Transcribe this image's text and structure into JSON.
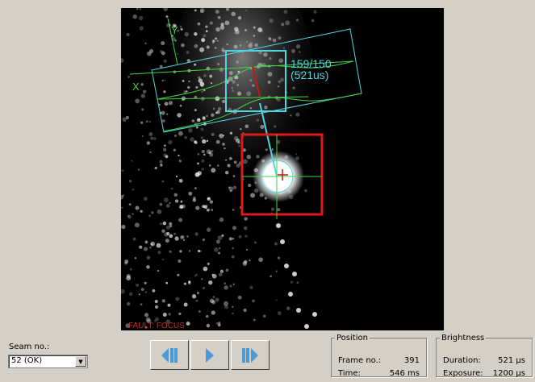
{
  "camera": {
    "overlay_value": "159/150",
    "overlay_time": "(521us)",
    "axis_x": "X",
    "axis_y": "Y",
    "fault": "FAULT: FOCUS"
  },
  "seam": {
    "label": "Seam no.:",
    "value": "52  (OK)"
  },
  "playback": {
    "prev": "step-back-icon",
    "play": "play-icon",
    "next": "step-forward-icon"
  },
  "position": {
    "title": "Position",
    "frame_label": "Frame no.:",
    "frame_value": "391",
    "time_label": "Time:",
    "time_value": "546 ms"
  },
  "brightness": {
    "title": "Brightness",
    "duration_label": "Duration:",
    "duration_value": "521 µs",
    "exposure_label": "Exposure:",
    "exposure_value": "1200 µs"
  },
  "colors": {
    "cyan": "#4fd6e0",
    "green": "#3fd63f",
    "red": "#e01818",
    "fault": "#c83030",
    "button_icon": "#4a9ad8"
  }
}
